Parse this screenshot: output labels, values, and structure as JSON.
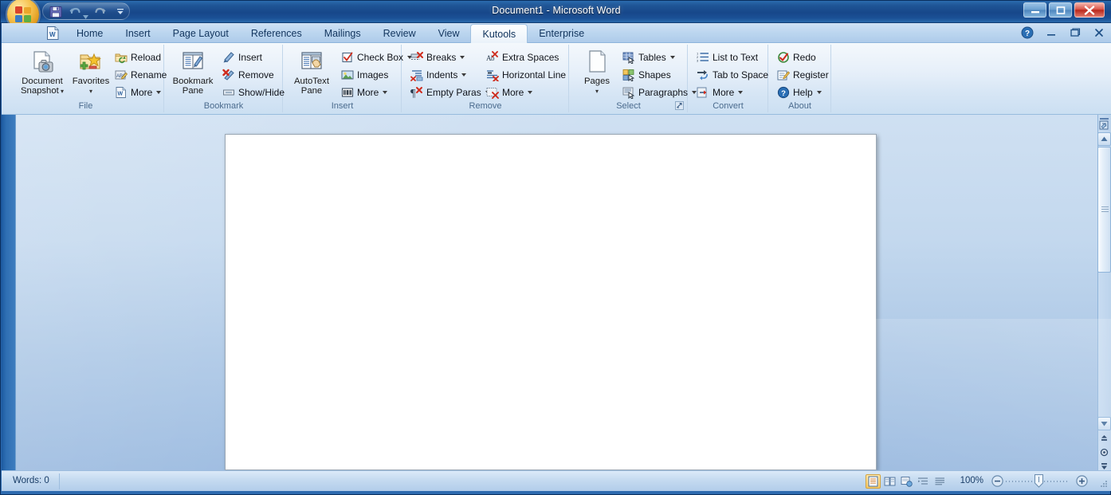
{
  "window": {
    "title": "Document1 - Microsoft Word",
    "minimize_label": "–",
    "maximize_label": "❐",
    "close_label": "✕"
  },
  "quick_access": {
    "save_label": "Save",
    "undo_label": "Undo",
    "redo_label": "Redo",
    "customize_label": "Customize Quick Access Toolbar"
  },
  "tabs": [
    {
      "label": "Home",
      "active": false
    },
    {
      "label": "Insert",
      "active": false
    },
    {
      "label": "Page Layout",
      "active": false
    },
    {
      "label": "References",
      "active": false
    },
    {
      "label": "Mailings",
      "active": false
    },
    {
      "label": "Review",
      "active": false
    },
    {
      "label": "View",
      "active": false
    },
    {
      "label": "Kutools",
      "active": true
    },
    {
      "label": "Enterprise",
      "active": false
    }
  ],
  "tabbar_right": {
    "help_label": "?",
    "minimize_ribbon_label": "–",
    "restore_label": "❐",
    "close_label": "✕"
  },
  "ribbon": {
    "groups": [
      {
        "name": "File",
        "label": "File",
        "big_buttons": [
          {
            "label_line1": "Document",
            "label_line2": "Snapshot",
            "has_caret": true,
            "icon": "document-snapshot-icon"
          },
          {
            "label_line1": "Favorites",
            "label_line2": "",
            "has_caret": true,
            "icon": "favorites-icon"
          }
        ],
        "small_buttons": [
          {
            "label": "Reload",
            "icon": "reload-folder-icon",
            "caret": false
          },
          {
            "label": "Rename",
            "icon": "rename-abc-icon",
            "caret": false
          },
          {
            "label": "More",
            "icon": "more-word-doc-icon",
            "caret": true
          }
        ]
      },
      {
        "name": "Bookmark",
        "label": "Bookmark",
        "big_buttons": [
          {
            "label_line1": "Bookmark",
            "label_line2": "Pane",
            "has_caret": false,
            "icon": "bookmark-pane-icon"
          }
        ],
        "small_buttons": [
          {
            "label": "Insert",
            "icon": "bookmark-insert-icon",
            "caret": false
          },
          {
            "label": "Remove",
            "icon": "bookmark-remove-icon",
            "caret": false
          },
          {
            "label": "Show/Hide",
            "icon": "bookmark-showhide-icon",
            "caret": false
          }
        ]
      },
      {
        "name": "Insert",
        "label": "Insert",
        "big_buttons": [
          {
            "label_line1": "AutoText",
            "label_line2": "Pane",
            "has_caret": false,
            "icon": "autotext-pane-icon"
          }
        ],
        "small_buttons": [
          {
            "label": "Check Box",
            "icon": "check-box-icon",
            "caret": true
          },
          {
            "label": "Images",
            "icon": "images-icon",
            "caret": false
          },
          {
            "label": "More",
            "icon": "more-barcode-icon",
            "caret": true
          }
        ]
      },
      {
        "name": "Remove",
        "label": "Remove",
        "big_buttons": [],
        "small_buttons": [
          {
            "label": "Breaks",
            "icon": "breaks-icon",
            "caret": true
          },
          {
            "label": "Indents",
            "icon": "indents-icon",
            "caret": true
          },
          {
            "label": "Empty Paras",
            "icon": "empty-paras-icon",
            "caret": true
          },
          {
            "label": "Extra Spaces",
            "icon": "extra-spaces-icon",
            "caret": false
          },
          {
            "label": "Horizontal Line",
            "icon": "horizontal-line-icon",
            "caret": false
          },
          {
            "label": "More",
            "icon": "remove-more-icon",
            "caret": true
          }
        ]
      },
      {
        "name": "Select",
        "label": "Select",
        "has_dialog_launcher": true,
        "big_buttons": [
          {
            "label_line1": "Pages",
            "label_line2": "",
            "has_caret": true,
            "icon": "pages-icon"
          }
        ],
        "small_buttons": [
          {
            "label": "Tables",
            "icon": "tables-icon",
            "caret": true
          },
          {
            "label": "Shapes",
            "icon": "shapes-icon",
            "caret": false
          },
          {
            "label": "Paragraphs",
            "icon": "paragraphs-icon",
            "caret": true
          }
        ]
      },
      {
        "name": "Convert",
        "label": "Convert",
        "big_buttons": [],
        "small_buttons": [
          {
            "label": "List to Text",
            "icon": "list-to-text-icon",
            "caret": false
          },
          {
            "label": "Tab to Space",
            "icon": "tab-to-space-icon",
            "caret": false
          },
          {
            "label": "More",
            "icon": "convert-more-icon",
            "caret": true
          }
        ]
      },
      {
        "name": "About",
        "label": "About",
        "big_buttons": [],
        "small_buttons": [
          {
            "label": "Redo",
            "icon": "redo-icon",
            "caret": false
          },
          {
            "label": "Register",
            "icon": "register-icon",
            "caret": false
          },
          {
            "label": "Help",
            "icon": "help-icon",
            "caret": true
          }
        ]
      }
    ]
  },
  "status_bar": {
    "words_label": "Words: 0",
    "zoom_level": "100%",
    "view_buttons": [
      {
        "name": "print-layout-view",
        "active": true
      },
      {
        "name": "full-screen-reading-view",
        "active": false
      },
      {
        "name": "web-layout-view",
        "active": false
      },
      {
        "name": "outline-view",
        "active": false
      },
      {
        "name": "draft-view",
        "active": false
      }
    ],
    "zoom_out_label": "−",
    "zoom_in_label": "+"
  },
  "colors": {
    "title_bar_blue": "#1b5296",
    "ribbon_bg": "#e6eff9",
    "tab_active": "#f2f7fc",
    "doc_bg": "#adc8e6",
    "page_white": "#ffffff",
    "group_label": "#4b6b8e",
    "close_red": "#b9281c",
    "accent_orange": "#e09b1e"
  }
}
